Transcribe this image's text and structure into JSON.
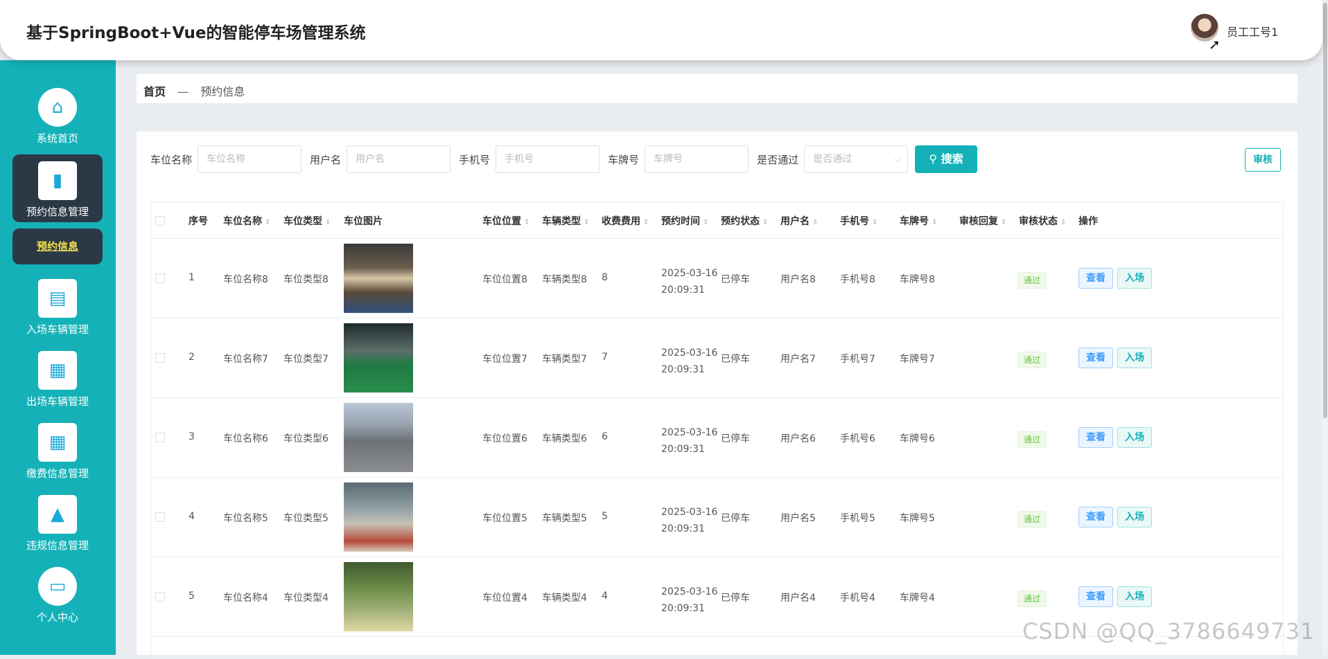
{
  "app": {
    "title": "基于SpringBoot+Vue的智能停车场管理系统",
    "user_name": "员工工号1"
  },
  "sidebar": {
    "items": [
      {
        "label": "系统首页",
        "icon": "home-icon",
        "glyph": "⌂"
      },
      {
        "label": "预约信息管理",
        "icon": "brush-icon",
        "glyph": "▮"
      },
      {
        "label": "入场车辆管理",
        "icon": "briefcase-icon",
        "glyph": "▤"
      },
      {
        "label": "出场车辆管理",
        "icon": "grid-icon",
        "glyph": "▦"
      },
      {
        "label": "缴费信息管理",
        "icon": "grid-icon",
        "glyph": "▦"
      },
      {
        "label": "违规信息管理",
        "icon": "stamp-icon",
        "glyph": "▲"
      },
      {
        "label": "个人中心",
        "icon": "card-icon",
        "glyph": "▭"
      }
    ],
    "submenu_label": "预约信息"
  },
  "breadcrumb": {
    "home": "首页",
    "separator": "—",
    "current": "预约信息"
  },
  "search": {
    "fields": [
      {
        "label": "车位名称",
        "placeholder": "车位名称"
      },
      {
        "label": "用户名",
        "placeholder": "用户名"
      },
      {
        "label": "手机号",
        "placeholder": "手机号"
      },
      {
        "label": "车牌号",
        "placeholder": "车牌号"
      }
    ],
    "select_label": "是否通过",
    "select_placeholder": "是否通过",
    "search_button": "搜索",
    "audit_button": "审核"
  },
  "table": {
    "columns": [
      "序号",
      "车位名称",
      "车位类型",
      "车位图片",
      "车位位置",
      "车辆类型",
      "收费费用",
      "预约时间",
      "预约状态",
      "用户名",
      "手机号",
      "车牌号",
      "审核回复",
      "审核状态",
      "操作"
    ],
    "rows": [
      {
        "index": "1",
        "name": "车位名称8",
        "type": "车位类型8",
        "location": "车位位置8",
        "vehicle_type": "车辆类型8",
        "fee": "8",
        "date": "2025-03-16",
        "time": "20:09:31",
        "status": "已停车",
        "username": "用户名8",
        "phone": "手机号8",
        "plate": "车牌号8",
        "reply": "",
        "audit": "通过",
        "view": "查看",
        "enter": "入场"
      },
      {
        "index": "2",
        "name": "车位名称7",
        "type": "车位类型7",
        "location": "车位位置7",
        "vehicle_type": "车辆类型7",
        "fee": "7",
        "date": "2025-03-16",
        "time": "20:09:31",
        "status": "已停车",
        "username": "用户名7",
        "phone": "手机号7",
        "plate": "车牌号7",
        "reply": "",
        "audit": "通过",
        "view": "查看",
        "enter": "入场"
      },
      {
        "index": "3",
        "name": "车位名称6",
        "type": "车位类型6",
        "location": "车位位置6",
        "vehicle_type": "车辆类型6",
        "fee": "6",
        "date": "2025-03-16",
        "time": "20:09:31",
        "status": "已停车",
        "username": "用户名6",
        "phone": "手机号6",
        "plate": "车牌号6",
        "reply": "",
        "audit": "通过",
        "view": "查看",
        "enter": "入场"
      },
      {
        "index": "4",
        "name": "车位名称5",
        "type": "车位类型5",
        "location": "车位位置5",
        "vehicle_type": "车辆类型5",
        "fee": "5",
        "date": "2025-03-16",
        "time": "20:09:31",
        "status": "已停车",
        "username": "用户名5",
        "phone": "手机号5",
        "plate": "车牌号5",
        "reply": "",
        "audit": "通过",
        "view": "查看",
        "enter": "入场"
      },
      {
        "index": "5",
        "name": "车位名称4",
        "type": "车位类型4",
        "location": "车位位置4",
        "vehicle_type": "车辆类型4",
        "fee": "4",
        "date": "2025-03-16",
        "time": "20:09:31",
        "status": "已停车",
        "username": "用户名4",
        "phone": "手机号4",
        "plate": "车牌号4",
        "reply": "",
        "audit": "通过",
        "view": "查看",
        "enter": "入场"
      }
    ]
  },
  "watermark": "CSDN @QQ_3786649731",
  "colors": {
    "primary": "#14b2b8",
    "sidebar_active": "#2b3947",
    "submenu_text": "#f7e04a",
    "tag_success": "#67c23a",
    "link_blue": "#409eff"
  }
}
